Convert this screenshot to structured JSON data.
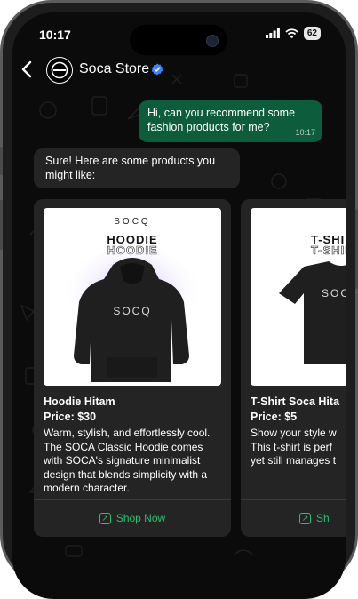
{
  "status_bar": {
    "time": "10:17",
    "battery": "62"
  },
  "header": {
    "store_name": "Soca Store"
  },
  "messages": {
    "outgoing": {
      "text": "Hi, can you recommend some fashion products for me?",
      "time": "10:17"
    },
    "incoming": {
      "text": "Sure! Here are some products you might like:"
    }
  },
  "products": [
    {
      "brand": "SOCQ",
      "big_text": "HOODIE",
      "print": "SOCQ",
      "name": "Hoodie Hitam",
      "price": "Price: $30",
      "desc_lines": [
        "Warm, stylish, and effortlessly cool.",
        "The SOCA Classic Hoodie comes",
        "with SOCA's signature minimalist",
        "design that blends simplicity with a",
        "modern character."
      ],
      "cta": "Shop Now"
    },
    {
      "big_text": "T-SHIRT",
      "print": "SOC",
      "name": "T-Shirt Soca Hita",
      "price": "Price: $5",
      "desc_lines": [
        "Show your style w",
        "This t-shirt is perf",
        "yet still manages t"
      ],
      "cta": "Sh"
    }
  ],
  "colors": {
    "accent": "#25c16f",
    "outgoing_bubble": "#0d5c3c",
    "incoming_bubble": "#242424",
    "verified": "#3b82f6"
  }
}
